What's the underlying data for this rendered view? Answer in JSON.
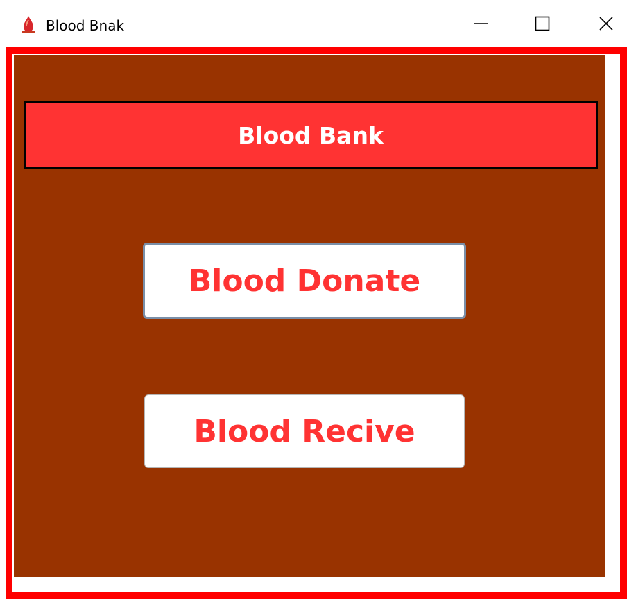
{
  "window": {
    "title": "Blood Bnak",
    "icon": "blood-drop-icon",
    "controls": [
      "minimize-icon",
      "maximize-icon",
      "close-icon"
    ]
  },
  "header": {
    "title": "Blood Bank"
  },
  "actions": {
    "donate_label": "Blood Donate",
    "recive_label": "Blood Recive"
  },
  "colors": {
    "frame_border": "#ff0000",
    "content_background": "#993300",
    "header_background": "#ff3333",
    "header_text": "#ffffff",
    "button_background": "#ffffff",
    "button_text": "#ff3333"
  }
}
